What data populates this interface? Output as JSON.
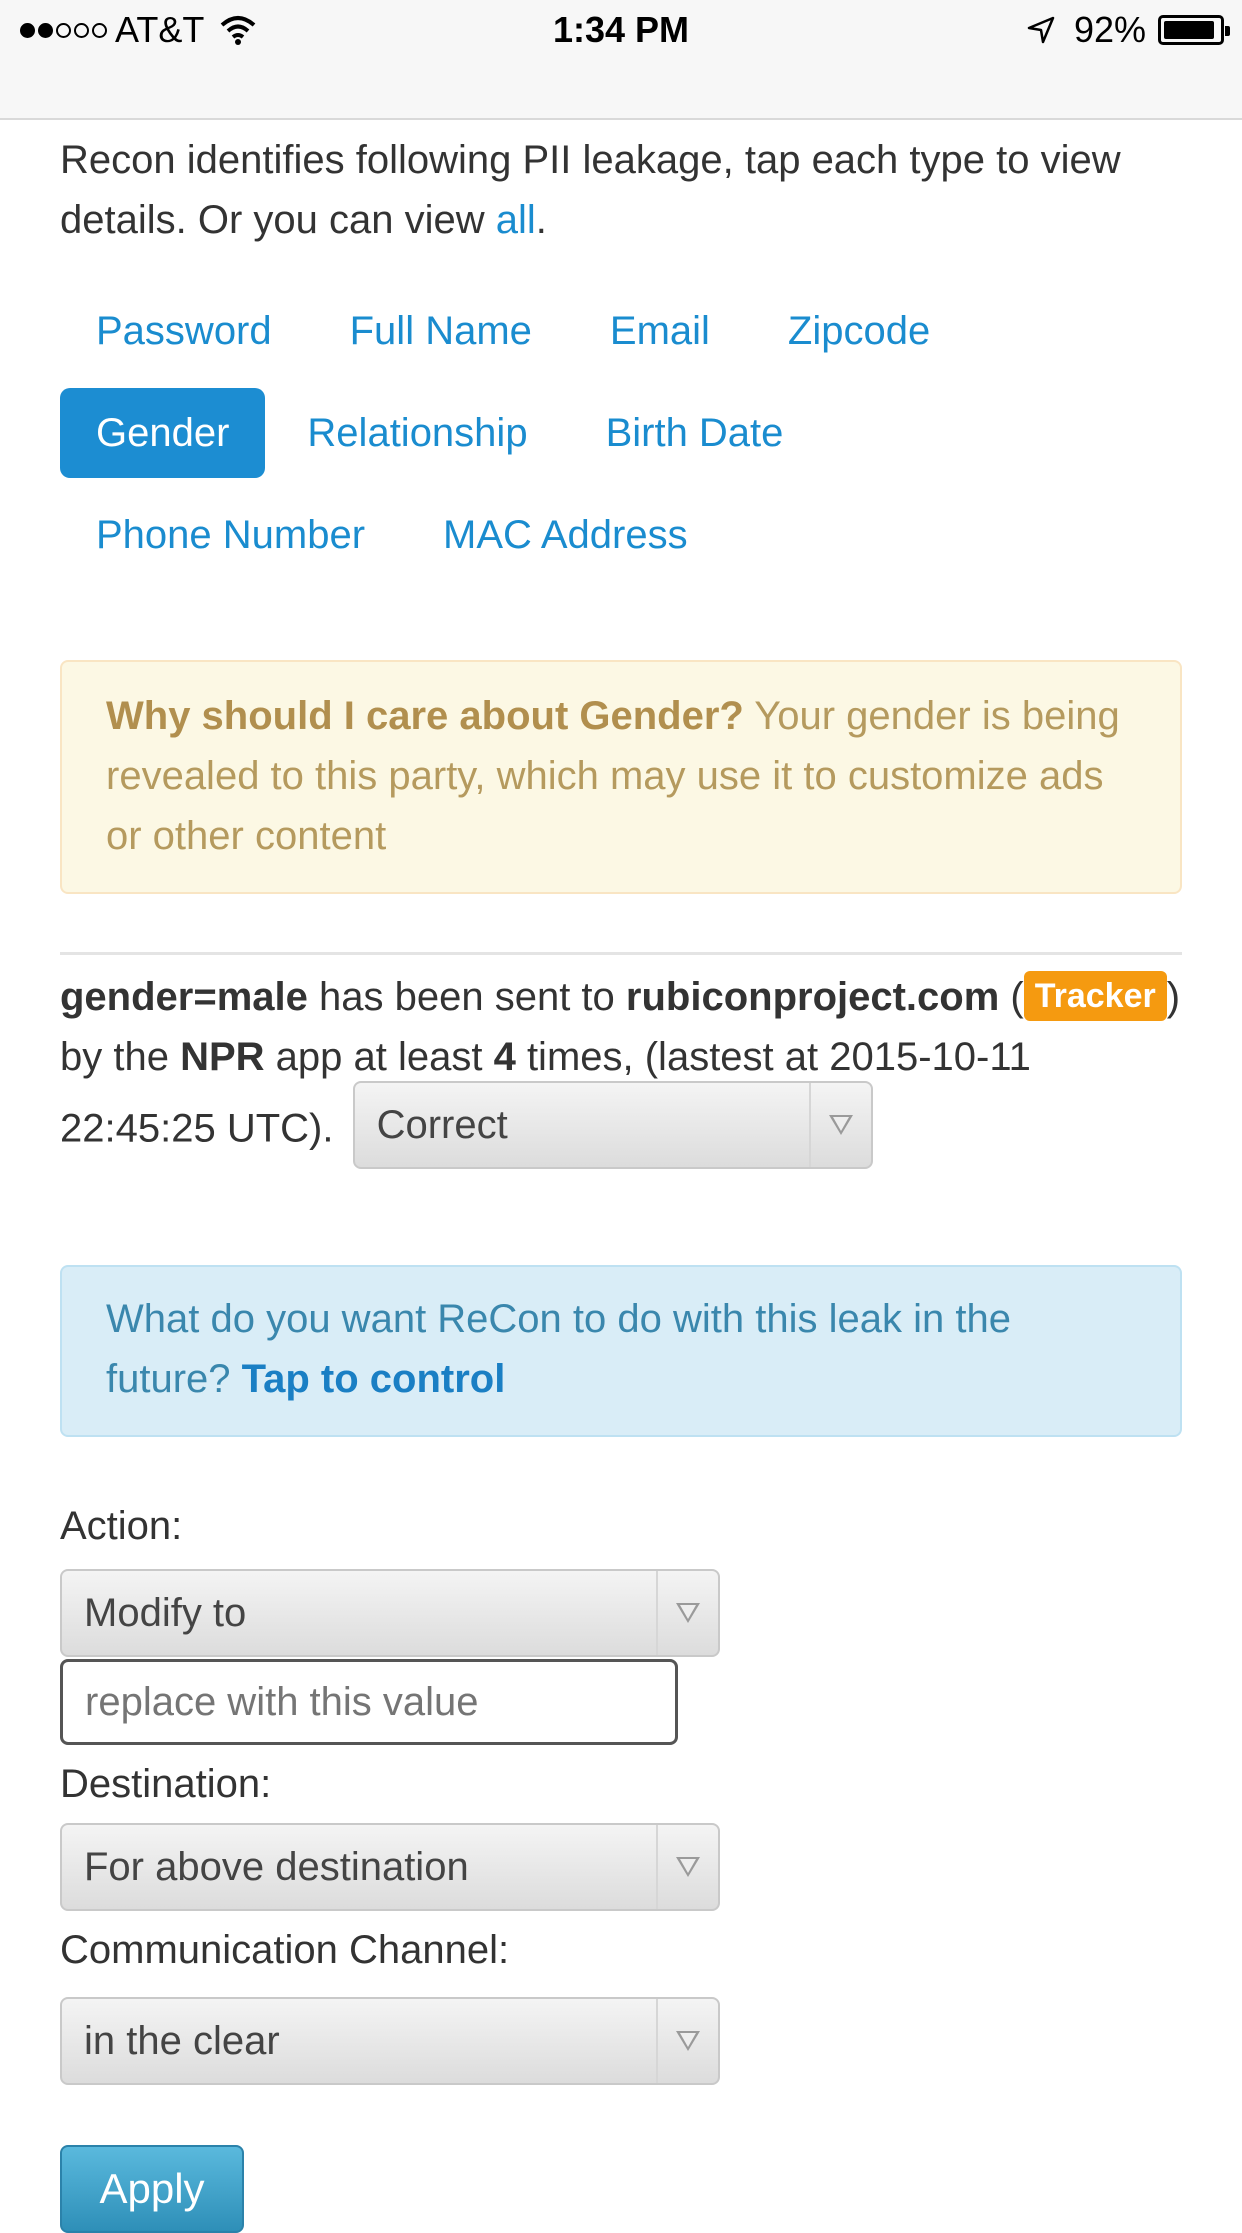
{
  "status_bar": {
    "carrier": "AT&T",
    "signal_bars_filled": 2,
    "signal_bars_total": 5,
    "time": "1:34 PM",
    "battery_percent": "92%",
    "battery_level": 0.92
  },
  "intro": {
    "text": "Recon identifies following PII leakage, tap each type to view details. Or you can view ",
    "link": "all",
    "suffix": "."
  },
  "pii_types": {
    "row1": [
      "Password",
      "Full Name",
      "Email",
      "Zipcode"
    ],
    "row2": [
      "Gender",
      "Relationship",
      "Birth Date"
    ],
    "row3": [
      "Phone Number",
      "MAC Address"
    ],
    "active": "Gender"
  },
  "warning": {
    "title": "Why should I care about Gender?",
    "body": " Your gender is being revealed to this party, which may use it to customize ads or other content"
  },
  "leak": {
    "key_value": "gender=male",
    "t1": " has been sent to ",
    "domain": "rubiconproject.com",
    "t2": " (",
    "tracker_badge": "Tracker",
    "t3": ") by the ",
    "app": "NPR",
    "t4": " app at least ",
    "count": "4",
    "t5": " times, (lastest at 2015-10-11 22:45:25 UTC).",
    "feedback_select": "Correct"
  },
  "control": {
    "question": "What do you want ReCon to do with this leak in the future? ",
    "link": "Tap to control"
  },
  "form": {
    "action_label": "Action:",
    "action_value": "Modify to",
    "replace_placeholder": "replace with this value",
    "destination_label": "Destination:",
    "destination_value": "For above destination",
    "channel_label": "Communication Channel:",
    "channel_value": "in the clear",
    "apply_label": "Apply"
  },
  "colors": {
    "link": "#1a8ccf",
    "active_pill": "#1c8dd2",
    "tracker_badge": "#f59a10",
    "warning_bg": "#fcf8e4",
    "info_bg": "#d9edf7",
    "apply_button": "#2e8fb8"
  }
}
